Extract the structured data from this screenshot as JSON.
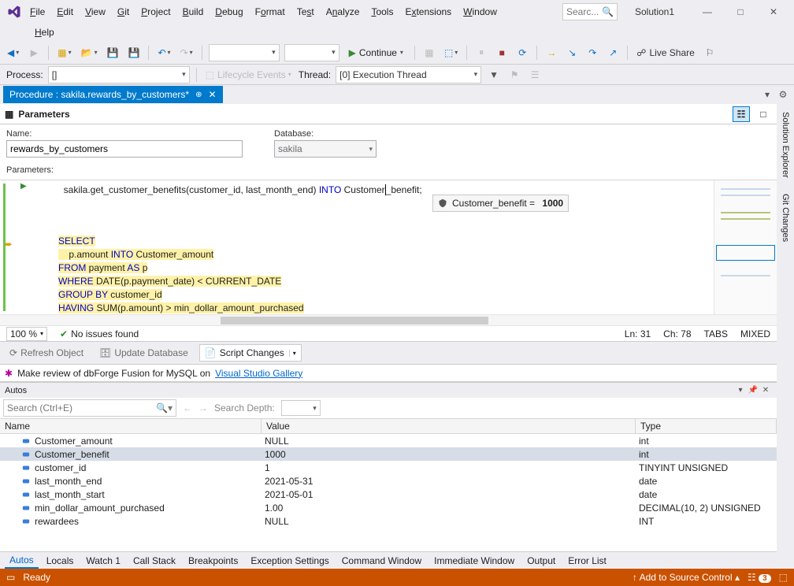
{
  "menus": [
    "File",
    "Edit",
    "View",
    "Git",
    "Project",
    "Build",
    "Debug",
    "Format",
    "Test",
    "Analyze",
    "Tools",
    "Extensions",
    "Window"
  ],
  "help_menu": "Help",
  "search_placeholder": "Searc...",
  "solution": "Solution1",
  "continue_label": "Continue",
  "live_share": "Live Share",
  "process_label": "Process:",
  "process_value": "[]",
  "lifecycle_label": "Lifecycle Events",
  "thread_label": "Thread:",
  "thread_value": "[0] Execution Thread",
  "doc_tab": "Procedure : sakila.rewards_by_customers*",
  "side_tabs": [
    "Solution Explorer",
    "Git Changes"
  ],
  "params_title": "Parameters",
  "name_label": "Name:",
  "name_value": "rewards_by_customers",
  "db_label": "Database:",
  "db_value": "sakila",
  "params_label": "Parameters:",
  "code_line1_pre": "  sakila.get_customer_benefits(customer_id, last_month_end) ",
  "code_line1_kw": "INTO",
  "code_line1_post1": " Customer",
  "code_line1_post2": "_benefit;",
  "tooltip_text": "Customer_benefit = ",
  "tooltip_val": "1000",
  "code_sel": "SELECT",
  "code_l2a": "    p.amount ",
  "code_l2kw": "INTO",
  "code_l2b": " Customer_amount",
  "code_l3kw": "FROM",
  "code_l3": " payment ",
  "code_l3kw2": "AS",
  "code_l3b": " p",
  "code_l4kw": "WHERE",
  "code_l4": " DATE(p.payment_date) < CURRENT_DATE",
  "code_l5kw": "GROUP BY",
  "code_l5": " customer_id",
  "code_l6kw": "HAVING",
  "code_l6": " SUM(p.amount) > min_dollar_amount_purchased",
  "zoom": "100 %",
  "issues": "No issues found",
  "ln": "Ln: 31",
  "ch": "Ch: 78",
  "tabs_mode": "TABS",
  "mixed": "MIXED",
  "refresh": "Refresh Object",
  "update_db": "Update Database",
  "script_changes": "Script Changes",
  "promo_pre": "Make review of dbForge Fusion for MySQL on ",
  "promo_link": "Visual Studio Gallery",
  "autos_title": "Autos",
  "autos_search": "Search (Ctrl+E)",
  "depth_lbl": "Search Depth:",
  "cols": {
    "name": "Name",
    "value": "Value",
    "type": "Type"
  },
  "rows": [
    {
      "n": "Customer_amount",
      "v": "NULL",
      "t": "int"
    },
    {
      "n": "Customer_benefit",
      "v": "1000",
      "t": "int"
    },
    {
      "n": "customer_id",
      "v": "1",
      "t": "TINYINT UNSIGNED"
    },
    {
      "n": "last_month_end",
      "v": "2021-05-31",
      "t": "date"
    },
    {
      "n": "last_month_start",
      "v": "2021-05-01",
      "t": "date"
    },
    {
      "n": "min_dollar_amount_purchased",
      "v": "1.00",
      "t": "DECIMAL(10, 2) UNSIGNED"
    },
    {
      "n": "rewardees",
      "v": "NULL",
      "t": "INT"
    }
  ],
  "btabs": [
    "Autos",
    "Locals",
    "Watch 1",
    "Call Stack",
    "Breakpoints",
    "Exception Settings",
    "Command Window",
    "Immediate Window",
    "Output",
    "Error List"
  ],
  "status_ready": "Ready",
  "add_src": "Add to Source Control",
  "badge": "3"
}
